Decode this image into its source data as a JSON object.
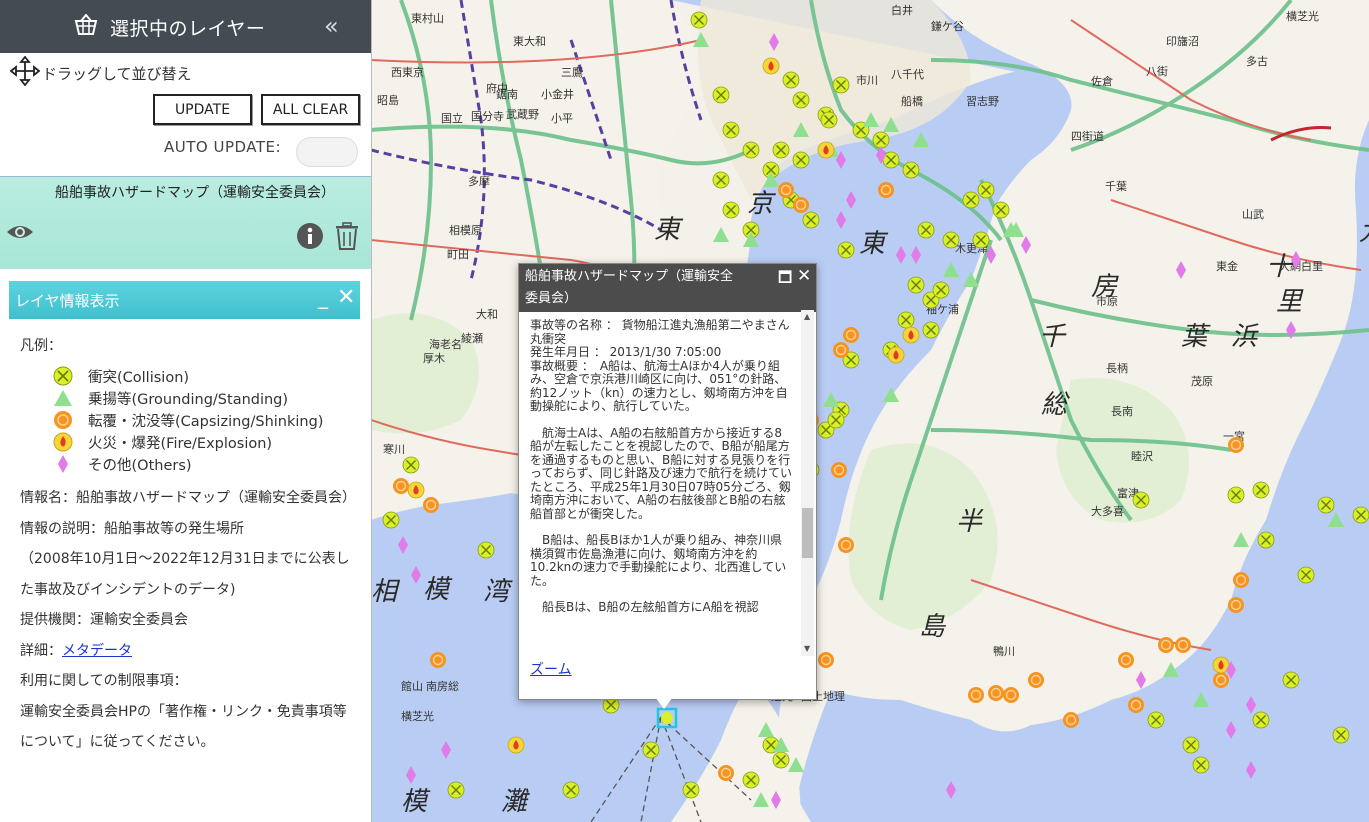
{
  "sidebar": {
    "title": "選択中のレイヤー",
    "drag_label": "ドラッグして並び替え",
    "update_label": "UPDATE",
    "clear_label": "ALL CLEAR",
    "auto_update_label": "AUTO UPDATE:",
    "auto_update_on": false
  },
  "layer": {
    "name": "船舶事故ハザードマップ（運輸安全委員会）"
  },
  "info_panel": {
    "title": "レイヤ情報表示",
    "min_label": "_",
    "close_label": "✕",
    "legend_title": "凡例：",
    "legend": [
      {
        "icon": "collision",
        "label": "衝突(Collision)",
        "color": "#d8f02a"
      },
      {
        "icon": "grounding",
        "label": "乗揚等(Grounding/Standing)",
        "color": "#8ee08e"
      },
      {
        "icon": "capsizing",
        "label": "転覆・沈没等(Capsizing/Shinking)",
        "color": "#f7931e"
      },
      {
        "icon": "fire",
        "label": "火災・爆発(Fire/Explosion)",
        "color": "#f5d63a"
      },
      {
        "icon": "others",
        "label": "その他(Others)",
        "color": "#e07be8"
      }
    ],
    "name_line": "情報名：船舶事故ハザードマップ（運輸安全委員会）",
    "desc_line1": "情報の説明：船舶事故等の発生場所",
    "desc_line2": "（2008年10月1日～2022年12月31日までに公表した事故及びインシデントのデータ)",
    "provider_line": "提供機関：運輸安全委員会",
    "detail_prefix": "詳細：",
    "detail_link": "メタデータ",
    "restrict_title": "利用に関しての制限事項：",
    "restrict_text": "運輸安全委員会HPの「著作権・リンク・免責事項等について」に従ってください。"
  },
  "popup": {
    "title": "船舶事故ハザードマップ（運輸安全委員会）",
    "max_label": "🗖",
    "close_label": "✕",
    "paragraphs": [
      "事故等の名称 ： 貨物船江進丸漁船第二やまさん丸衝突\n発生年月日 ： 2013/1/30 7:05:00\n事故概要 ：　A船は、航海士Aほか4人が乗り組み、空倉で京浜港川崎区に向け、051°の針路、約12ノット（kn）の速力とし、剱埼南方沖を自動操舵により、航行していた。",
      "　航海士Aは、A船の右舷船首方から接近する8船が左転したことを視認したので、B船が船尾方を通過するものと思い、B船に対する見張りを行っておらず、同じ針路及び速力で航行を続けていたところ、平成25年1月30日07時05分ごろ、剱埼南方沖において、A船の右舷後部とB船の右舷船首部とが衝突した。",
      "　B船は、船長Bほか1人が乗り組み、神奈川県横須賀市佐島漁港に向け、剱埼南方沖を約10.2knの速力で手動操舵により、北西進していた。",
      "　船長Bは、B船の左舷船首方にA船を視認"
    ],
    "zoom_label": "ズーム"
  },
  "map": {
    "sea_color": "#b9cdf4",
    "land_color": "#f4f2ea",
    "labels": [
      {
        "text": "東",
        "size": "big"
      },
      {
        "text": "京",
        "size": "big"
      },
      {
        "text": "東",
        "size": "big"
      },
      {
        "text": "房",
        "size": "big"
      },
      {
        "text": "千",
        "size": "big"
      },
      {
        "text": "葉",
        "size": "big"
      },
      {
        "text": "総",
        "size": "big"
      },
      {
        "text": "半",
        "size": "big"
      },
      {
        "text": "島",
        "size": "big"
      },
      {
        "text": "相",
        "size": "big"
      },
      {
        "text": "模",
        "size": "big"
      },
      {
        "text": "湾",
        "size": "big"
      },
      {
        "text": "模",
        "size": "big"
      },
      {
        "text": "灘",
        "size": "big"
      },
      {
        "text": "九",
        "size": "big"
      },
      {
        "text": "十",
        "size": "big"
      },
      {
        "text": "浜",
        "size": "big"
      },
      {
        "text": "里",
        "size": "big"
      },
      {
        "text": "印旛沼",
        "size": "small"
      },
      {
        "text": "多古",
        "size": "small"
      },
      {
        "text": "佐倉",
        "size": "small"
      },
      {
        "text": "八街",
        "size": "small"
      },
      {
        "text": "四街道",
        "size": "small"
      },
      {
        "text": "千葉",
        "size": "small"
      },
      {
        "text": "市原",
        "size": "small"
      },
      {
        "text": "長柄",
        "size": "small"
      },
      {
        "text": "茂原",
        "size": "small"
      },
      {
        "text": "長南",
        "size": "small"
      },
      {
        "text": "睦沢",
        "size": "small"
      },
      {
        "text": "一宮",
        "size": "small"
      },
      {
        "text": "大多喜",
        "size": "small"
      },
      {
        "text": "富津",
        "size": "small"
      },
      {
        "text": "鴨川",
        "size": "small"
      },
      {
        "text": "木更津",
        "size": "small"
      },
      {
        "text": "袖ケ浦",
        "size": "small"
      },
      {
        "text": "横芝光",
        "size": "small"
      },
      {
        "text": "山武",
        "size": "small"
      },
      {
        "text": "東金",
        "size": "small"
      },
      {
        "text": "大網白里",
        "size": "small"
      },
      {
        "text": "白井",
        "size": "small"
      },
      {
        "text": "鎌ケ谷",
        "size": "small"
      },
      {
        "text": "八千代",
        "size": "small"
      },
      {
        "text": "船橋",
        "size": "small"
      },
      {
        "text": "習志野",
        "size": "small"
      },
      {
        "text": "市川",
        "size": "small"
      },
      {
        "text": "多摩",
        "size": "small"
      },
      {
        "text": "国立",
        "size": "small"
      },
      {
        "text": "昭島",
        "size": "small"
      },
      {
        "text": "町田",
        "size": "small"
      },
      {
        "text": "相模原",
        "size": "small"
      },
      {
        "text": "大和",
        "size": "small"
      },
      {
        "text": "綾瀬",
        "size": "small"
      },
      {
        "text": "海老名",
        "size": "small"
      },
      {
        "text": "厚木",
        "size": "small"
      },
      {
        "text": "寒川",
        "size": "small"
      },
      {
        "text": "西東京",
        "size": "small"
      },
      {
        "text": "東村山",
        "size": "small"
      },
      {
        "text": "小金井",
        "size": "small"
      },
      {
        "text": "三鷹",
        "size": "small"
      },
      {
        "text": "府中",
        "size": "small"
      },
      {
        "text": "国分寺",
        "size": "small"
      },
      {
        "text": "武蔵野",
        "size": "small"
      },
      {
        "text": "小平",
        "size": "small"
      },
      {
        "text": "東大和",
        "size": "small"
      },
      {
        "text": "鋸南",
        "size": "small"
      },
      {
        "text": "館山",
        "size": "small"
      },
      {
        "text": "南房総",
        "size": "small"
      },
      {
        "text": "横芝光",
        "size": "small"
      },
      {
        "text": "芝光",
        "size": "small"
      },
      {
        "text": "国土地理",
        "size": "small"
      }
    ]
  }
}
